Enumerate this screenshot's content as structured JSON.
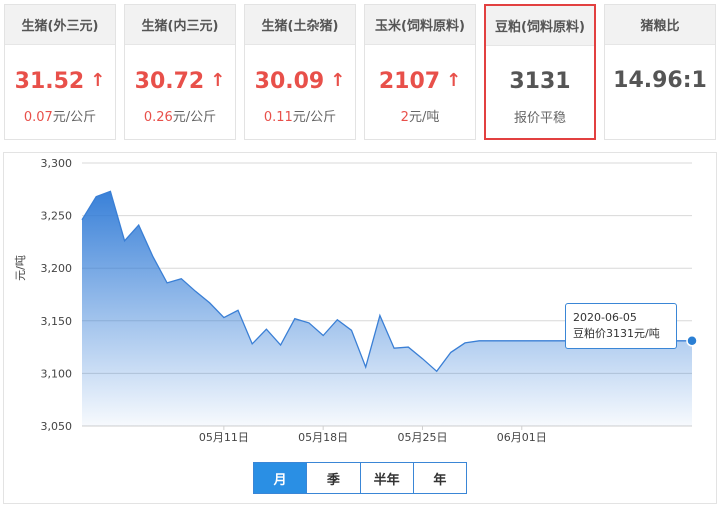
{
  "cards": [
    {
      "title": "生猪(外三元)",
      "value": "31.52",
      "trend": "up",
      "change_num": "0.07",
      "change_unit": "元/公斤"
    },
    {
      "title": "生猪(内三元)",
      "value": "30.72",
      "trend": "up",
      "change_num": "0.26",
      "change_unit": "元/公斤"
    },
    {
      "title": "生猪(土杂猪)",
      "value": "30.09",
      "trend": "up",
      "change_num": "0.11",
      "change_unit": "元/公斤"
    },
    {
      "title": "玉米(饲料原料)",
      "value": "2107",
      "trend": "up",
      "change_num": "2",
      "change_unit": "元/吨"
    },
    {
      "title": "豆粕(饲料原料)",
      "value": "3131",
      "trend": "flat",
      "status": "报价平稳",
      "selected": true
    },
    {
      "title": "猪粮比",
      "value": "14.96:1",
      "trend": "none"
    }
  ],
  "arrow_glyph": "↑",
  "tooltip": {
    "date": "2020-06-05",
    "label": "豆粕价3131元/吨"
  },
  "periods": [
    {
      "label": "月",
      "active": true
    },
    {
      "label": "季",
      "active": false
    },
    {
      "label": "半年",
      "active": false
    },
    {
      "label": "年",
      "active": false
    }
  ],
  "colors": {
    "accent": "#2a8fe4",
    "up": "#e8504a",
    "selected_border": "#e24040",
    "line": "#3a7fd5"
  },
  "chart_data": {
    "type": "area",
    "ylabel": "元/吨",
    "ylim": [
      3050,
      3300
    ],
    "yticks": [
      "3,050",
      "3,100",
      "3,150",
      "3,200",
      "3,250",
      "3,300"
    ],
    "ytick_values": [
      3050,
      3100,
      3150,
      3200,
      3250,
      3300
    ],
    "xlabels": [
      {
        "day": 10,
        "text": "05月11日"
      },
      {
        "day": 17,
        "text": "05月18日"
      },
      {
        "day": 24,
        "text": "05月25日"
      },
      {
        "day": 31,
        "text": "06月01日"
      }
    ],
    "x_days": [
      0,
      1,
      2,
      3,
      4,
      5,
      6,
      7,
      8,
      9,
      10,
      11,
      12,
      13,
      14,
      15,
      16,
      17,
      18,
      19,
      20,
      21,
      22,
      23,
      24,
      25,
      26,
      27,
      28,
      29,
      30,
      31,
      32,
      33,
      34,
      35,
      36,
      37,
      38,
      39,
      40,
      41,
      42,
      43
    ],
    "values": [
      3246,
      3268,
      3273,
      3226,
      3241,
      3211,
      3186,
      3190,
      3178,
      3167,
      3153,
      3160,
      3128,
      3142,
      3127,
      3152,
      3148,
      3136,
      3151,
      3141,
      3106,
      3155,
      3124,
      3125,
      3114,
      3102,
      3120,
      3129,
      3131,
      3131,
      3131,
      3131,
      3131,
      3131,
      3131,
      3131,
      3131,
      3131,
      3131,
      3131,
      3131,
      3131,
      3131,
      3131
    ],
    "highlight_index": 43,
    "grid": true
  }
}
